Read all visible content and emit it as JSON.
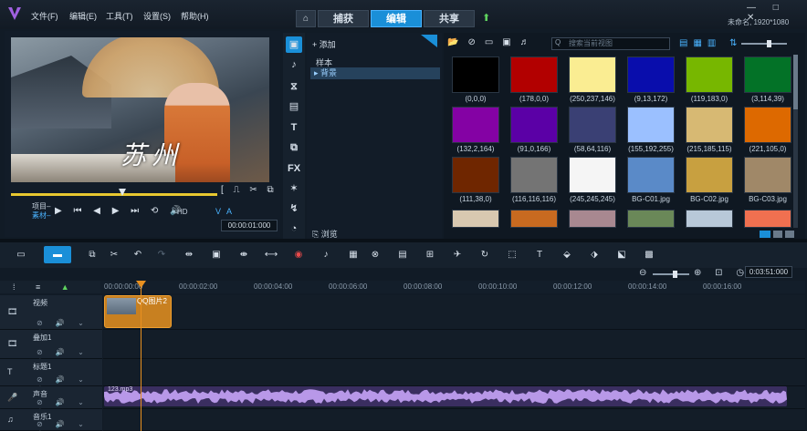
{
  "menu": [
    "文件(F)",
    "编辑(E)",
    "工具(T)",
    "设置(S)",
    "帮助(H)"
  ],
  "tabs": [
    "捕获",
    "编辑",
    "共享"
  ],
  "active_tab": "编辑",
  "window_controls": "— □ ✕",
  "project_info": "未命名, 1920*1080",
  "player": {
    "overlay_text": "苏州",
    "mode_project": "项目–",
    "mode_clip": "素材–",
    "quality": "HD",
    "timecode": "00:00:01:000",
    "va_label": "V A"
  },
  "library": {
    "add_label": "添加",
    "tree_item_1": "样本",
    "tree_item_2": "背景",
    "browse_label": "浏览",
    "search_placeholder": "搜索当前视图",
    "swatches": [
      {
        "label": "(0,0,0)",
        "color": "#000000"
      },
      {
        "label": "(178,0,0)",
        "color": "#b20000"
      },
      {
        "label": "(250,237,146)",
        "color": "#faed92"
      },
      {
        "label": "(9,13,172)",
        "color": "#090dac"
      },
      {
        "label": "(119,183,0)",
        "color": "#77b700"
      },
      {
        "label": "(3,114,39)",
        "color": "#037227"
      },
      {
        "label": "(132,2,164)",
        "color": "#8402a4"
      },
      {
        "label": "(91,0,166)",
        "color": "#5b00a6"
      },
      {
        "label": "(58,64,116)",
        "color": "#3a4074"
      },
      {
        "label": "(155,192,255)",
        "color": "#9bc0ff"
      },
      {
        "label": "(215,185,115)",
        "color": "#d7b973"
      },
      {
        "label": "(221,105,0)",
        "color": "#dd6900"
      },
      {
        "label": "(111,38,0)",
        "color": "#6f2600"
      },
      {
        "label": "(116,116,116)",
        "color": "#747474"
      },
      {
        "label": "(245,245,245)",
        "color": "#f5f5f5"
      },
      {
        "label": "BG-C01.jpg",
        "color": "#5a8ac8"
      },
      {
        "label": "BG-C02.jpg",
        "color": "#c8a040"
      },
      {
        "label": "BG-C03.jpg",
        "color": "#a08868"
      },
      {
        "label": "",
        "color": "#d8c8b0"
      },
      {
        "label": "",
        "color": "#c86a20"
      },
      {
        "label": "",
        "color": "#a88890"
      },
      {
        "label": "",
        "color": "#6a8858"
      },
      {
        "label": "",
        "color": "#b8c8d8"
      },
      {
        "label": "",
        "color": "#f07050"
      }
    ]
  },
  "timeline": {
    "zoom_timecode": "0:03:51:000",
    "ruler": [
      "00:00:00:00",
      "00:00:02:00",
      "00:00:04:00",
      "00:00:06:00",
      "00:00:08:00",
      "00:00:10:00",
      "00:00:12:00",
      "00:00:14:00",
      "00:00:16:00"
    ],
    "tracks": [
      {
        "name": "视频",
        "icon": "🎞"
      },
      {
        "name": "叠加1",
        "icon": "🎞"
      },
      {
        "name": "标题1",
        "icon": "T"
      },
      {
        "name": "声音",
        "icon": "🎤"
      },
      {
        "name": "音乐1",
        "icon": "♫"
      }
    ],
    "video_clip_label": "QQ图片2",
    "audio_clip_label": "123.mp3"
  }
}
